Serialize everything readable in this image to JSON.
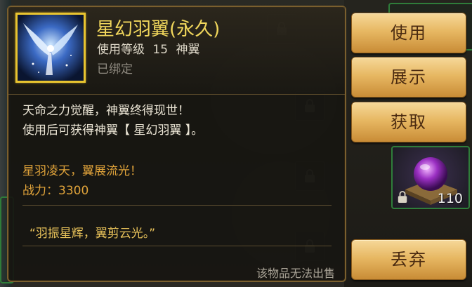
{
  "item": {
    "name": "星幻羽翼(永久)",
    "meta": "使用等级 15  神翼",
    "bind_status": "已绑定",
    "icon": "angel-wings-icon"
  },
  "description": {
    "line1": "天命之力觉醒，神翼终得现世！",
    "line2": "使用后可获得神翼【 星幻羽翼 】。"
  },
  "flavor": {
    "line1": "星羽凌天，翼展流光！",
    "power": "战力：3300"
  },
  "quote": "“羽振星辉，翼剪云光。”",
  "sell_note": "该物品无法出售",
  "buttons": {
    "use": "使用",
    "show": "展示",
    "obtain": "获取",
    "discard": "丢弃"
  },
  "slot": {
    "count": "110",
    "icon": "purple-orb-icon"
  },
  "colors": {
    "title": "#f1d75c",
    "flavor": "#e0a33a",
    "frame": "#e8c430",
    "button": "#e7b863"
  }
}
